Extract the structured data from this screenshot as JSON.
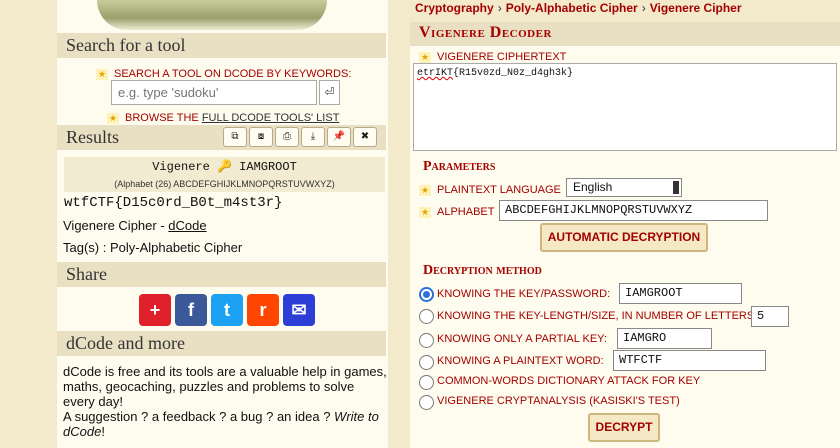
{
  "breadcrumb": [
    "Cryptography",
    "Poly-Alphabetic Cipher",
    "Vigenere Cipher"
  ],
  "sidebar": {
    "search_title": "Search for a tool",
    "search_hint": "SEARCH A TOOL ON DCODE BY KEYWORDS:",
    "search_placeholder": "e.g. type 'sudoku'",
    "enter_glyph": "⏎",
    "browse_prefix": "BROWSE THE ",
    "browse_link": "FULL DCODE TOOLS' LIST",
    "results_title": "Results",
    "result_toolbar": [
      "⧉",
      "⧇",
      "⎙",
      "⤓",
      "📌",
      "✖"
    ],
    "result_key_line": "Vigenere 🔑 IAMGROOT",
    "result_alphabet": "(Alphabet (26) ABCDEFGHIJKLMNOPQRSTUVWXYZ)",
    "result_output": "wtfCTF{D15c0rd_B0t_m4st3r}",
    "credit_prefix": "Vigenere Cipher - ",
    "credit_link": "dCode",
    "tags": "Tag(s) : Poly-Alphabetic Cipher",
    "share_title": "Share",
    "share_buttons": [
      "+",
      "f",
      "t",
      "r",
      "✉"
    ],
    "more_title": "dCode and more",
    "about_text": "dCode is free and its tools are a valuable help in games, maths, geocaching, puzzles and problems to solve every day!",
    "feedback_text": "A suggestion ? a feedback ? a bug ? an idea ? ",
    "feedback_link": "Write to dCode",
    "feedback_end": "!"
  },
  "decoder": {
    "title": "Vigenere Decoder",
    "ciphertext_label": "VIGENERE CIPHERTEXT",
    "ciphertext_word": "etrIKT",
    "ciphertext_rest": "{R15v0zd_N0z_d4gh3k}",
    "parameters_title": "Parameters",
    "language_label": "PLAINTEXT LANGUAGE",
    "language_value": "English",
    "alphabet_label": "ALPHABET",
    "alphabet_value": "ABCDEFGHIJKLMNOPQRSTUVWXYZ",
    "auto_button": "AUTOMATIC DECRYPTION",
    "method_title": "Decryption method",
    "methods": [
      {
        "label": "KNOWING THE KEY/PASSWORD:",
        "value": "IAMGROOT",
        "selected": true
      },
      {
        "label": "KNOWING THE KEY-LENGTH/SIZE, IN NUMBER OF LETTERS:",
        "value": "5",
        "selected": false
      },
      {
        "label": "KNOWING ONLY A PARTIAL KEY:",
        "value": "IAMGRO",
        "selected": false
      },
      {
        "label": "KNOWING A PLAINTEXT WORD:",
        "value": "WTFCTF",
        "selected": false
      },
      {
        "label": "COMMON-WORDS DICTIONARY ATTACK FOR KEY",
        "value": "",
        "selected": false
      },
      {
        "label": "VIGENERE CRYPTANALYSIS (KASISKI'S TEST)",
        "value": "",
        "selected": false
      }
    ],
    "decrypt_button": "DECRYPT"
  },
  "colors": {
    "accent_red": "#a40000",
    "page_bg": "#f2eacb",
    "panel_bg": "#fefcee",
    "header_bg": "#e9dfc3",
    "radio_blue": "#2a6fdb"
  }
}
